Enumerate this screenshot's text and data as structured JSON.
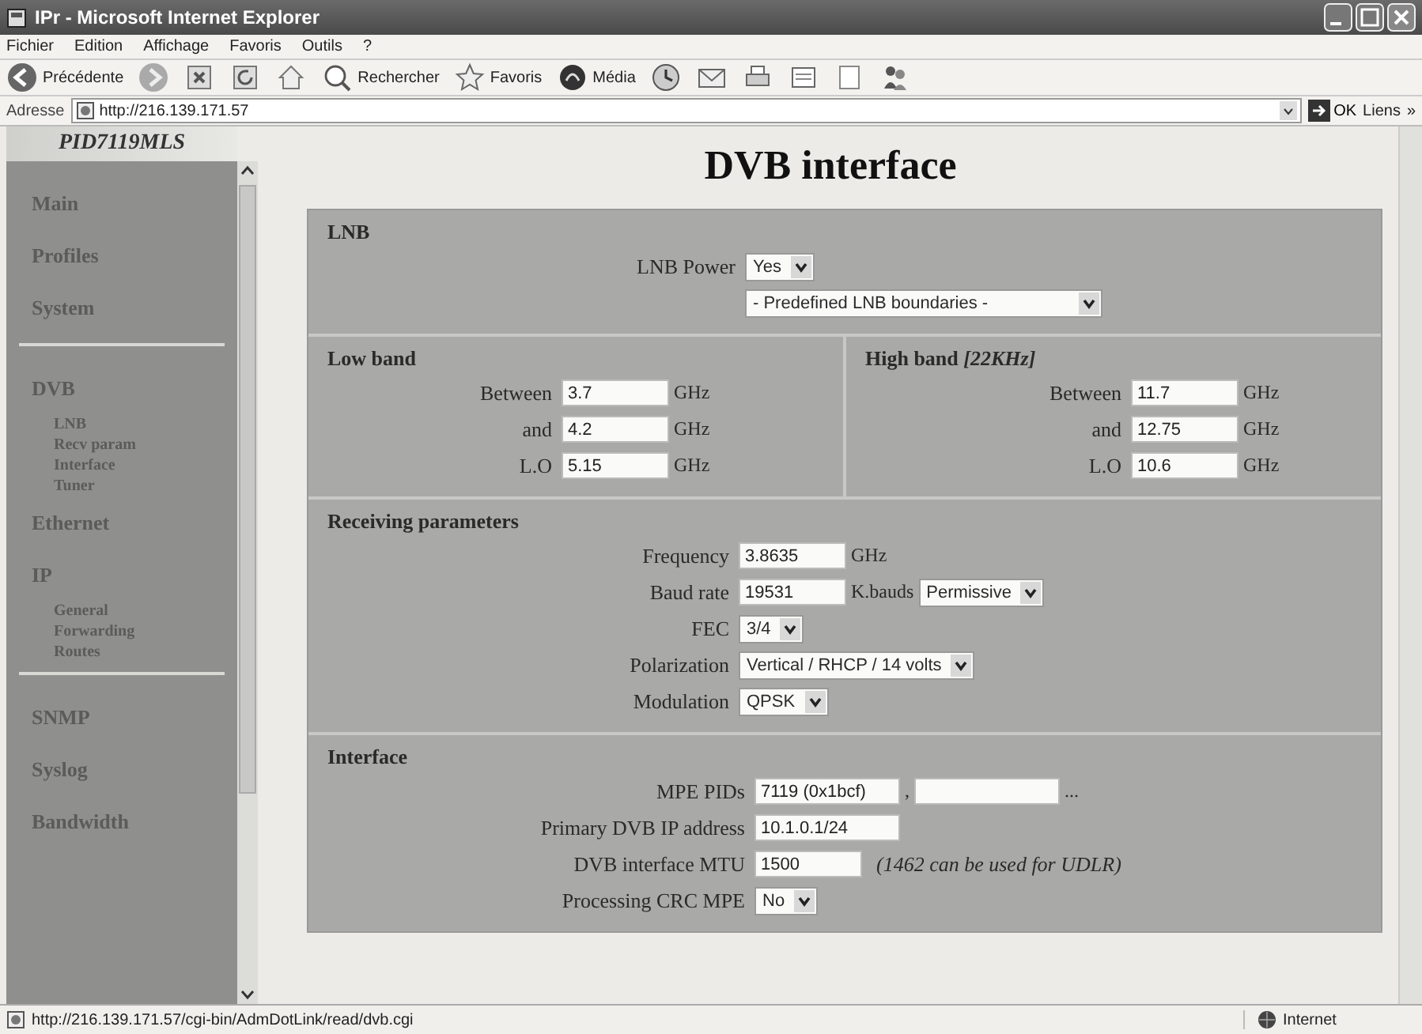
{
  "window": {
    "title": "IPr - Microsoft Internet Explorer"
  },
  "menu": [
    "Fichier",
    "Edition",
    "Affichage",
    "Favoris",
    "Outils",
    "?"
  ],
  "toolbar": [
    {
      "kind": "back",
      "label": "Précédente"
    },
    {
      "kind": "forward"
    },
    {
      "kind": "stop"
    },
    {
      "kind": "refresh"
    },
    {
      "kind": "home"
    },
    {
      "kind": "search",
      "label": "Rechercher"
    },
    {
      "kind": "favorites",
      "label": "Favoris"
    },
    {
      "kind": "media",
      "label": "Média"
    },
    {
      "kind": "history"
    },
    {
      "kind": "mail"
    },
    {
      "kind": "print"
    },
    {
      "kind": "edit"
    },
    {
      "kind": "discuss"
    },
    {
      "kind": "messenger"
    }
  ],
  "address": {
    "label": "Adresse",
    "url": "http://216.139.171.57",
    "go": "OK",
    "links": "Liens",
    "links_more": "»"
  },
  "sidebar": {
    "title": "PID7119MLS",
    "groups": [
      {
        "items": [
          {
            "label": "Main"
          },
          {
            "label": "Profiles"
          },
          {
            "label": "System"
          }
        ]
      },
      {
        "items": [
          {
            "label": "DVB",
            "children": [
              {
                "label": "LNB"
              },
              {
                "label": "Recv param"
              },
              {
                "label": "Interface"
              },
              {
                "label": "Tuner"
              }
            ]
          },
          {
            "label": "Ethernet"
          },
          {
            "label": "IP",
            "children": [
              {
                "label": "General"
              },
              {
                "label": "Forwarding"
              },
              {
                "label": "Routes"
              }
            ]
          }
        ]
      },
      {
        "items": [
          {
            "label": "SNMP"
          },
          {
            "label": "Syslog"
          },
          {
            "label": "Bandwidth"
          }
        ]
      }
    ]
  },
  "page": {
    "title": "DVB interface",
    "lnb": {
      "title": "LNB",
      "rows": [
        {
          "label": "LNB Power",
          "fields": [
            {
              "kind": "select",
              "value": "Yes"
            }
          ]
        },
        {
          "fields": [
            {
              "kind": "wide-select",
              "value": "- Predefined LNB boundaries -"
            }
          ]
        }
      ]
    },
    "bands": [
      {
        "title": "Low band",
        "rows": [
          {
            "label": "Between",
            "fields": [
              {
                "kind": "input",
                "value": "3.7"
              },
              {
                "kind": "unit",
                "value": "GHz"
              }
            ]
          },
          {
            "label": "and",
            "fields": [
              {
                "kind": "input",
                "value": "4.2"
              },
              {
                "kind": "unit",
                "value": "GHz"
              }
            ]
          },
          {
            "label": "L.O",
            "fields": [
              {
                "kind": "input",
                "value": "5.15"
              },
              {
                "kind": "unit",
                "value": "GHz"
              }
            ]
          }
        ]
      },
      {
        "title": "High band *[22KHz]*",
        "rows": [
          {
            "label": "Between",
            "fields": [
              {
                "kind": "input",
                "value": "11.7"
              },
              {
                "kind": "unit",
                "value": "GHz"
              }
            ]
          },
          {
            "label": "and",
            "fields": [
              {
                "kind": "input",
                "value": "12.75"
              },
              {
                "kind": "unit",
                "value": "GHz"
              }
            ]
          },
          {
            "label": "L.O",
            "fields": [
              {
                "kind": "input",
                "value": "10.6"
              },
              {
                "kind": "unit",
                "value": "GHz"
              }
            ]
          }
        ]
      }
    ],
    "receiving": {
      "title": "Receiving parameters",
      "rows": [
        {
          "label": "Frequency",
          "fields": [
            {
              "kind": "input",
              "value": "3.8635"
            },
            {
              "kind": "unit",
              "value": "GHz"
            }
          ]
        },
        {
          "label": "Baud rate",
          "fields": [
            {
              "kind": "input",
              "value": "19531"
            },
            {
              "kind": "unit",
              "value": "K.bauds"
            },
            {
              "kind": "select",
              "value": "Permissive"
            }
          ]
        },
        {
          "label": "FEC",
          "fields": [
            {
              "kind": "select",
              "value": "3/4"
            }
          ]
        },
        {
          "label": "Polarization",
          "fields": [
            {
              "kind": "select",
              "value": "Vertical / RHCP / 14 volts"
            }
          ]
        },
        {
          "label": "Modulation",
          "fields": [
            {
              "kind": "select",
              "value": "QPSK"
            }
          ]
        }
      ]
    },
    "interface": {
      "title": "Interface",
      "rows": [
        {
          "label": "MPE PIDs",
          "fields": [
            {
              "kind": "wide-input",
              "value": "7119 (0x1bcf)"
            },
            {
              "kind": "unit",
              "value": ","
            },
            {
              "kind": "wide-input"
            },
            {
              "kind": "unit",
              "value": "..."
            }
          ]
        },
        {
          "label": "Primary DVB IP address",
          "fields": [
            {
              "kind": "wide-input",
              "value": "10.1.0.1/24"
            }
          ]
        },
        {
          "label": "DVB interface MTU",
          "fields": [
            {
              "kind": "input",
              "value": "1500"
            },
            {
              "kind": "note",
              "value": "(1462 can be used for UDLR)"
            }
          ]
        },
        {
          "label": "Processing CRC MPE",
          "fields": [
            {
              "kind": "select",
              "value": "No"
            }
          ]
        }
      ]
    }
  },
  "status_bar": {
    "url": "http://216.139.171.57/cgi-bin/AdmDotLink/read/dvb.cgi",
    "zone": "Internet"
  }
}
